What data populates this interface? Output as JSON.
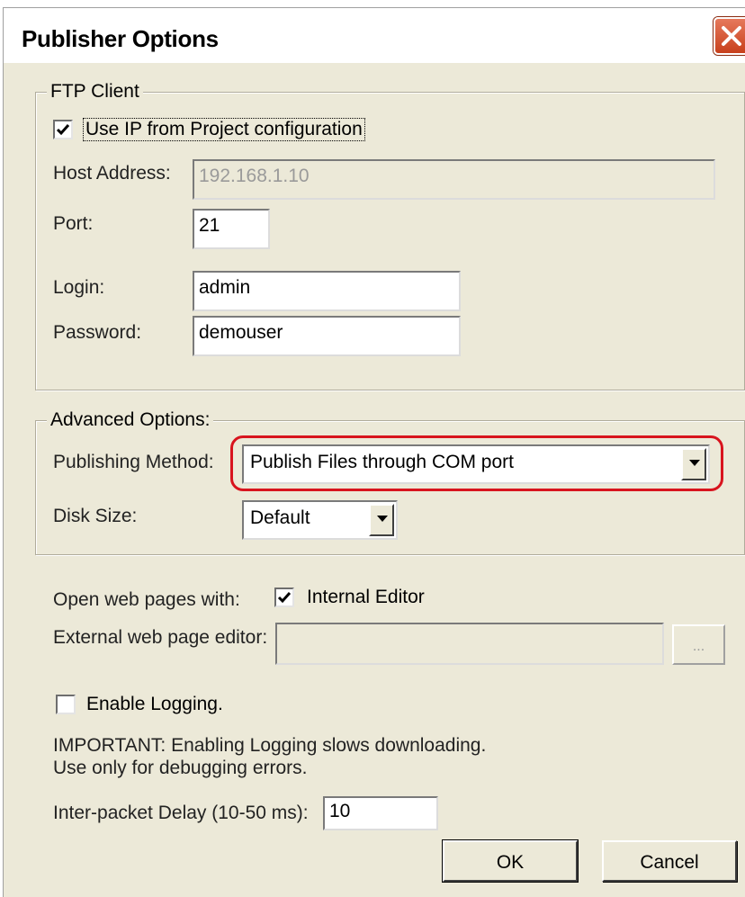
{
  "window": {
    "title": "Publisher Options",
    "close_icon": "close-icon"
  },
  "ftp": {
    "legend": "FTP Client",
    "use_ip_label": "Use IP from Project configuration",
    "use_ip_checked": true,
    "host_label": "Host Address:",
    "host_value": "192.168.1.10",
    "port_label": "Port:",
    "port_value": "21",
    "login_label": "Login:",
    "login_value": "admin",
    "password_label": "Password:",
    "password_value": "demouser"
  },
  "advanced": {
    "legend": "Advanced Options:",
    "method_label": "Publishing Method:",
    "method_value": "Publish Files through COM port",
    "disk_label": "Disk Size:",
    "disk_value": "Default",
    "highlight_color": "#d8141e"
  },
  "editor": {
    "open_label": "Open web pages with:",
    "internal_label": "Internal Editor",
    "internal_checked": true,
    "external_label": "External web page editor:",
    "external_value": "",
    "browse_label": "..."
  },
  "logging": {
    "enable_label": "Enable Logging.",
    "enable_checked": false,
    "important_line1": "IMPORTANT: Enabling Logging slows downloading.",
    "important_line2": "Use only for debugging errors.",
    "delay_label": "Inter-packet Delay (10-50 ms):",
    "delay_value": "10"
  },
  "buttons": {
    "ok_label": "OK",
    "cancel_label": "Cancel"
  }
}
